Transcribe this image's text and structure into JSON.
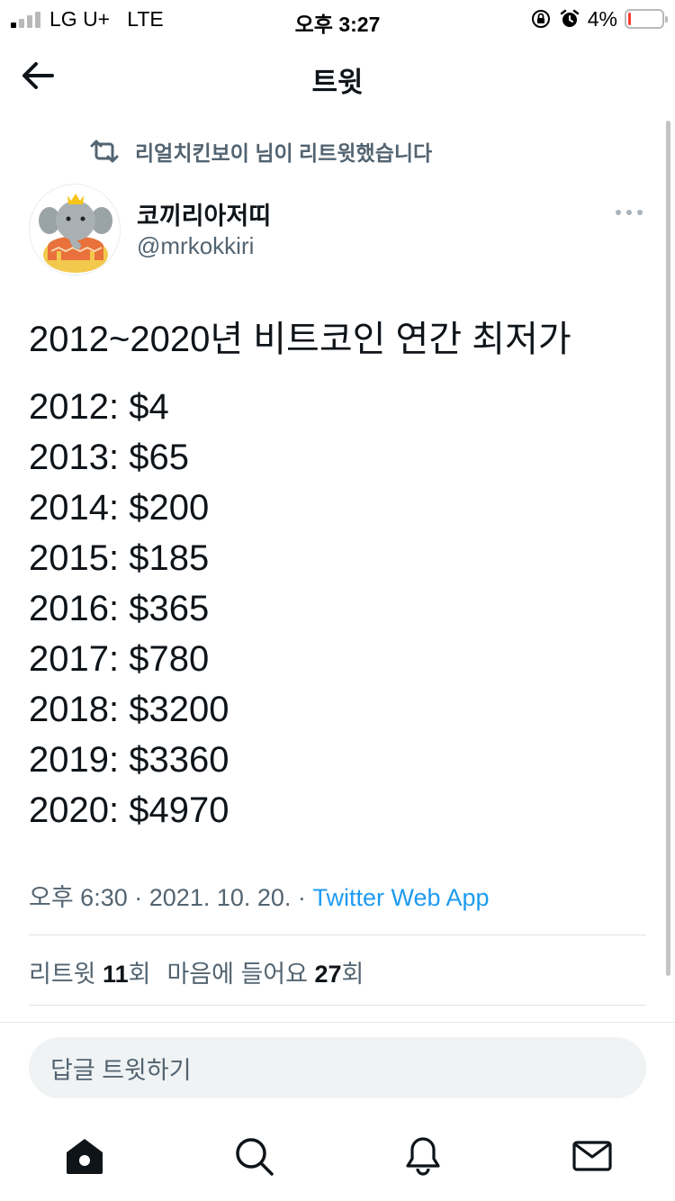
{
  "status_bar": {
    "carrier": "LG U+",
    "network": "LTE",
    "time": "오후 3:27",
    "battery_percent": "4%",
    "battery_level": 0.04,
    "battery_color": "#ff3b30"
  },
  "header": {
    "title": "트윗"
  },
  "retweet": {
    "text": "리얼치킨보이 님이 리트윗했습니다"
  },
  "author": {
    "name": "코끼리아저띠",
    "handle": "@mrkokkiri"
  },
  "tweet": {
    "headline": "2012~2020년 비트코인 연간 최저가",
    "lines": [
      "2012: $4",
      "2013: $65",
      "2014: $200",
      "2015: $185",
      "2016: $365",
      "2017: $780",
      "2018: $3200",
      "2019: $3360",
      "2020: $4970"
    ]
  },
  "meta": {
    "time": "오후 6:30",
    "separator": "·",
    "date": "2021. 10. 20.",
    "source": "Twitter Web App"
  },
  "stats": {
    "retweets_label": "리트윗",
    "retweets_count": "11",
    "retweets_suffix": "회",
    "likes_label": "마음에 들어요",
    "likes_count": "27",
    "likes_suffix": "회"
  },
  "reply": {
    "placeholder": "답글 트윗하기"
  },
  "tabs": {
    "icons": [
      "home-icon",
      "search-icon",
      "notifications-icon",
      "messages-icon"
    ]
  },
  "colors": {
    "accent": "#1d9bf0",
    "text": "#0f1419",
    "muted": "#536471"
  }
}
